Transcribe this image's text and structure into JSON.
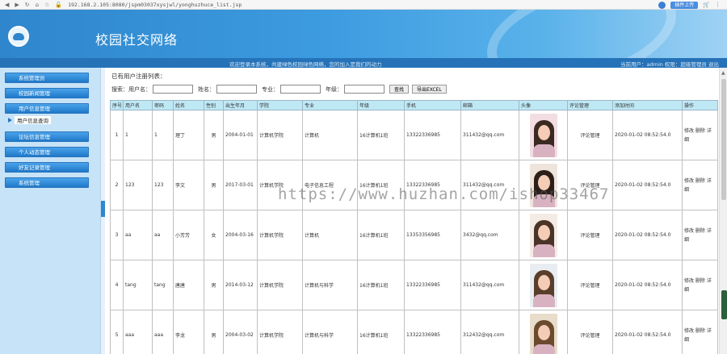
{
  "browser": {
    "url": "192.168.2.105:8080/jspm03037xysjwl/yonghuzhuce_list.jsp",
    "ext_label": "插件上传"
  },
  "header": {
    "title": "校园社交网络"
  },
  "status_bar": {
    "message": "欢迎登录本系统，共建绿色校园绿色网络，您的加入是我们的动力",
    "user_info": "当前用户：admin 权限：超级管理员 退出"
  },
  "sidebar": {
    "items": [
      {
        "label": "系统管理员"
      },
      {
        "label": "校园新闻管理"
      },
      {
        "label": "用户信息管理"
      },
      {
        "label": "论坛信息管理"
      },
      {
        "label": "个人动态管理"
      },
      {
        "label": "好友记录管理"
      },
      {
        "label": "系统管理"
      }
    ],
    "sub_item": "用户信息查询"
  },
  "main": {
    "caption": "已有用户注册列表：",
    "search": {
      "prefix": "搜索：",
      "username_label": "用户名：",
      "name_label": "姓名：",
      "major_label": "专业：",
      "grade_label": "年级：",
      "search_button": "查找",
      "export_button": "导出EXCEL"
    },
    "table": {
      "headers": [
        "序号",
        "用户名",
        "密码",
        "姓名",
        "性别",
        "出生年月",
        "学院",
        "专业",
        "年级",
        "手机",
        "邮箱",
        "头像",
        "评论管理",
        "添加时间",
        "操作"
      ],
      "rows": [
        {
          "no": "1",
          "username": "1",
          "password": "1",
          "name": "理丁",
          "gender": "男",
          "birth": "2004-01-01",
          "college": "计算机学院",
          "major": "计算机",
          "grade": "16计算机1班",
          "phone": "13322336985",
          "email": "311432@qq.com",
          "comment": "评论管理",
          "added": "2020-01-02 08:52:54.0",
          "ops": "修改 删除 详细"
        },
        {
          "no": "2",
          "username": "123",
          "password": "123",
          "name": "李文",
          "gender": "男",
          "birth": "2017-03-01",
          "college": "计算机学院",
          "major": "电子信息工程",
          "grade": "16计算机1班",
          "phone": "13322336985",
          "email": "311432@qq.com",
          "comment": "评论管理",
          "added": "2020-01-02 08:52:54.0",
          "ops": "修改 删除 详细"
        },
        {
          "no": "3",
          "username": "aa",
          "password": "aa",
          "name": "小芳芳",
          "gender": "女",
          "birth": "2004-03-16",
          "college": "计算机学院",
          "major": "计算机",
          "grade": "16计算机1班",
          "phone": "13353356985",
          "email": "3432@qq.com",
          "comment": "评论管理",
          "added": "2020-01-02 08:52:54.0",
          "ops": "修改 删除 详细"
        },
        {
          "no": "4",
          "username": "tang",
          "password": "tang",
          "name": "唐唐",
          "gender": "男",
          "birth": "2014-03-12",
          "college": "计算机学院",
          "major": "计算机与科学",
          "grade": "16计算机1班",
          "phone": "13322336985",
          "email": "311432@qq.com",
          "comment": "评论管理",
          "added": "2020-01-02 08:52:54.0",
          "ops": "修改 删除 详细"
        },
        {
          "no": "5",
          "username": "aaa",
          "password": "aaa",
          "name": "李龙",
          "gender": "男",
          "birth": "2004-03-02",
          "college": "计算机学院",
          "major": "计算机与科学",
          "grade": "16计算机1班",
          "phone": "13322336985",
          "email": "312432@qq.com",
          "comment": "评论管理",
          "added": "2020-01-02 08:52:54.0",
          "ops": "修改 删除 详细"
        }
      ]
    }
  },
  "watermark": "https://www.huzhan.com/ishop33467",
  "colors": {
    "header": "#2f86cc",
    "status_bar": "#2572b8",
    "sidebar_bg": "#c7e3f7",
    "table_header": "#bfe8f5"
  }
}
